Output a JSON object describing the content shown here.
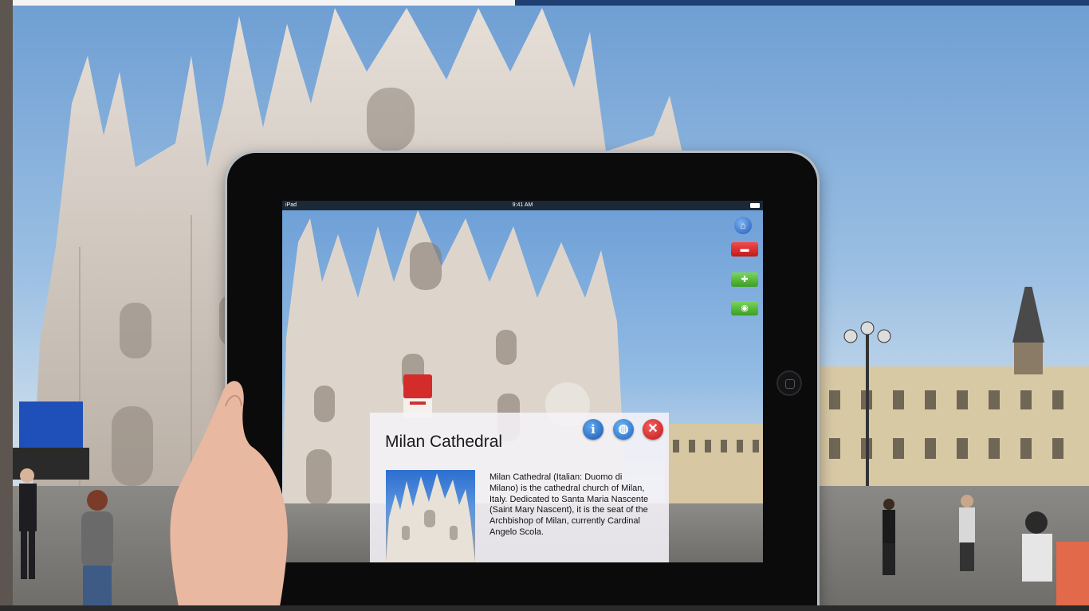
{
  "device": {
    "status_left": "iPad",
    "status_time": "9:41 AM"
  },
  "side_icons": [
    {
      "name": "home-icon",
      "glyph": "⌂",
      "color": "#1d5bbb"
    },
    {
      "name": "hotel-icon",
      "glyph": "▬",
      "color": "#c31818"
    },
    {
      "name": "restaurant-icon",
      "glyph": "✚",
      "color": "#3b9e22"
    },
    {
      "name": "camera-icon",
      "glyph": "◉",
      "color": "#3b9e22"
    }
  ],
  "card": {
    "title": "Milan Cathedral",
    "info_glyph": "i",
    "web_glyph": "◍",
    "close_glyph": "✕",
    "description": "Milan Cathedral (Italian: Duomo di Milano) is the cathedral church of Milan, Italy. Dedicated to Santa Maria Nascente (Saint Mary Nascent), it is the seat of the Archbishop of Milan, currently Cardinal Angelo Scola."
  },
  "colors": {
    "frame_top_left": "#f3f3f3",
    "frame_top_right": "#1f3f73",
    "ipad_body": "#0b0b0c",
    "card_bg": "#f5f3f8"
  }
}
